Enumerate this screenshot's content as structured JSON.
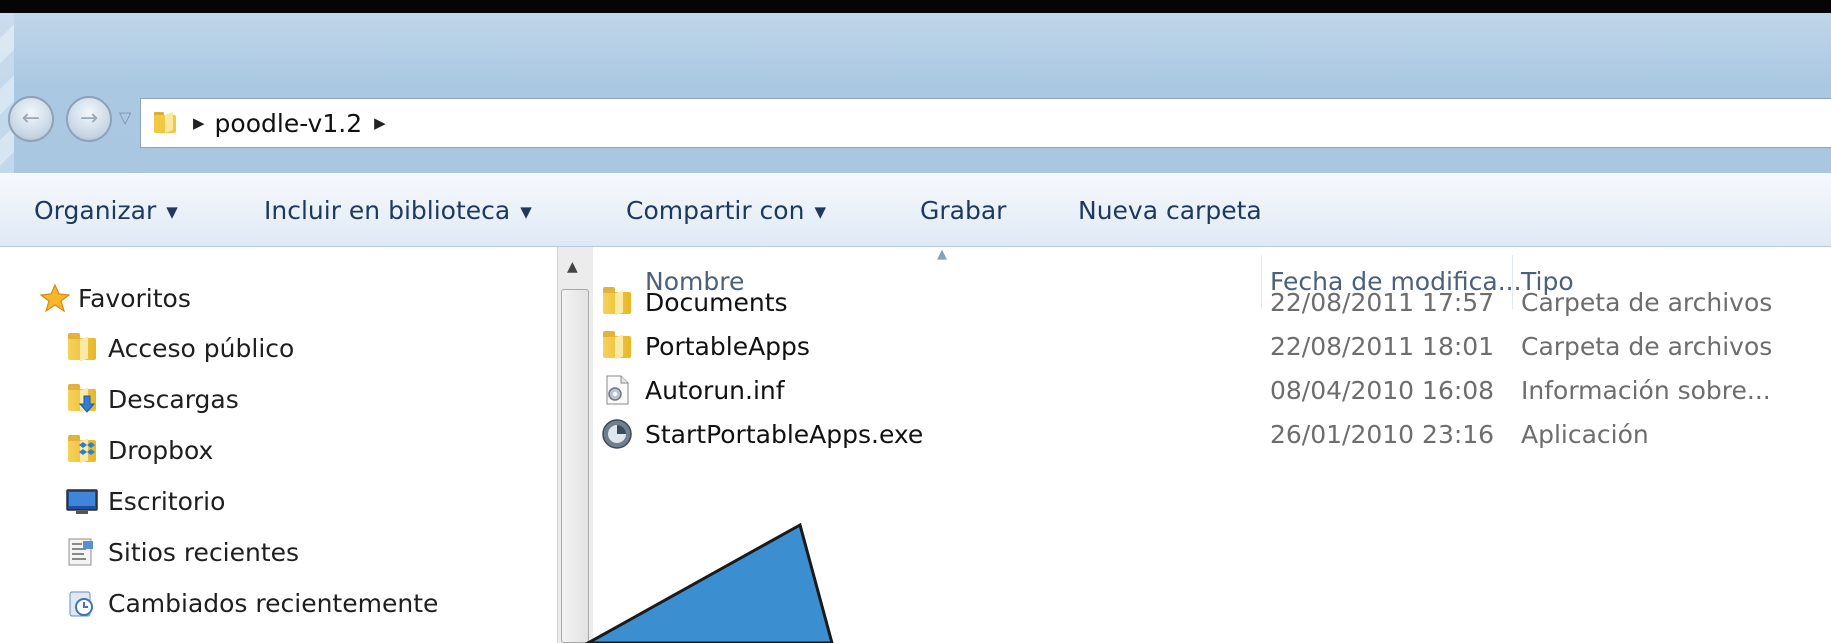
{
  "window": {
    "address_path": [
      "poodle-v1.2"
    ],
    "nav_back": "←",
    "nav_forward": "→",
    "history_dropdown": "▽"
  },
  "toolbar": {
    "items": [
      {
        "label": "Organizar",
        "caret": "▼"
      },
      {
        "label": "Incluir en biblioteca",
        "caret": "▼"
      },
      {
        "label": "Compartir con",
        "caret": "▼"
      },
      {
        "label": "Grabar"
      },
      {
        "label": "Nueva carpeta"
      }
    ]
  },
  "navpane": {
    "favorites_label": "Favoritos",
    "items": [
      {
        "label": "Acceso público",
        "icon": "folder-icon"
      },
      {
        "label": "Descargas",
        "icon": "downloads-folder-icon"
      },
      {
        "label": "Dropbox",
        "icon": "dropbox-folder-icon"
      },
      {
        "label": "Escritorio",
        "icon": "desktop-icon"
      },
      {
        "label": "Sitios recientes",
        "icon": "recent-places-icon"
      },
      {
        "label": "Cambiados recientemente",
        "icon": "recently-changed-icon"
      }
    ]
  },
  "filelist": {
    "columns": {
      "name": "Nombre",
      "date": "Fecha de modifica...",
      "type": "Tipo"
    },
    "sort_indicator": "▲",
    "rows": [
      {
        "name": "Documents",
        "date": "22/08/2011 17:57",
        "type": "Carpeta de archivos",
        "icon": "folder-icon"
      },
      {
        "name": "PortableApps",
        "date": "22/08/2011 18:01",
        "type": "Carpeta de archivos",
        "icon": "folder-icon"
      },
      {
        "name": "Autorun.inf",
        "date": "08/04/2010 16:08",
        "type": "Información sobre...",
        "icon": "settings-file-icon"
      },
      {
        "name": "StartPortableApps.exe",
        "date": "26/01/2010 23:16",
        "type": "Aplicación",
        "icon": "app-icon"
      }
    ]
  },
  "colors": {
    "title_bg": "#aac8e2",
    "toolbar_text": "#1e395b",
    "annotation_arrow": "#3b8fd1"
  }
}
